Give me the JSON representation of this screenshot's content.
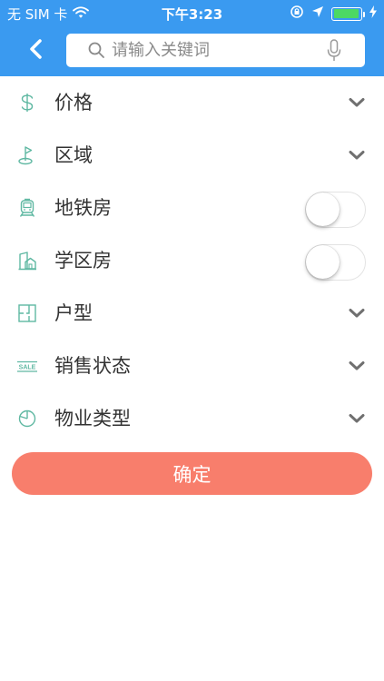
{
  "status_bar": {
    "carrier": "无 SIM 卡",
    "time": "下午3:23",
    "battery_level": 0.95
  },
  "header": {
    "back_icon": "chevron-left-icon",
    "search": {
      "placeholder": "请输入关键词",
      "value": ""
    }
  },
  "filters": [
    {
      "label": "价格",
      "icon": "dollar-icon",
      "control": "dropdown"
    },
    {
      "label": "区域",
      "icon": "flag-icon",
      "control": "dropdown"
    },
    {
      "label": "地铁房",
      "icon": "train-icon",
      "control": "toggle",
      "on": false
    },
    {
      "label": "学区房",
      "icon": "school-house-icon",
      "control": "toggle",
      "on": false
    },
    {
      "label": "户型",
      "icon": "floorplan-icon",
      "control": "dropdown"
    },
    {
      "label": "销售状态",
      "icon": "sale-tag-icon",
      "control": "dropdown",
      "icon_text": "SALE"
    },
    {
      "label": "物业类型",
      "icon": "pie-chart-icon",
      "control": "dropdown"
    }
  ],
  "confirm_label": "确定",
  "colors": {
    "header_bg": "#3a9af0",
    "icon_accent": "#5fb8a2",
    "confirm_bg": "#f87e6c",
    "battery": "#4cd964"
  }
}
